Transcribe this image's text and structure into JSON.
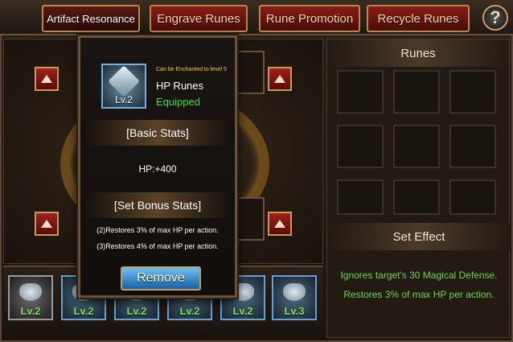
{
  "tabs": [
    {
      "label": "Artifact Resonance",
      "active": true
    },
    {
      "label": "Engrave Runes",
      "active": false
    },
    {
      "label": "Rune Promotion",
      "active": false
    },
    {
      "label": "Recycle Runes",
      "active": false
    }
  ],
  "help_label": "?",
  "popup": {
    "enchant_note": "Can be Enchanted to level 5",
    "rune_name": "HP Runes",
    "status": "Equipped",
    "level": "Lv.2",
    "basic_stats_header": "[Basic Stats]",
    "basic_stat": "HP:+400",
    "set_bonus_header": "[Set Bonus Stats]",
    "set_bonus_lines": [
      "(2)Restores 3% of max HP per action.",
      "(3)Restores 4% of max HP per action."
    ],
    "remove_label": "Remove"
  },
  "rune_bar": [
    {
      "level": "Lv.2"
    },
    {
      "level": "Lv.2"
    },
    {
      "level": "Lv.2"
    },
    {
      "level": "Lv.2"
    },
    {
      "level": "Lv.2"
    },
    {
      "level": "Lv.3"
    }
  ],
  "right_panel": {
    "runes_header": "Runes",
    "set_effect_header": "Set Effect",
    "effects": [
      "Ignores target's 30 Magical Defense.",
      "Restores 3% of max HP per action."
    ]
  },
  "colors": {
    "tab_red": "#8a1c14",
    "effect_green": "#6fd44e",
    "equipped_green": "#44dd44",
    "enchant_yellow": "#ffcc33",
    "remove_blue": "#1a60a8"
  }
}
